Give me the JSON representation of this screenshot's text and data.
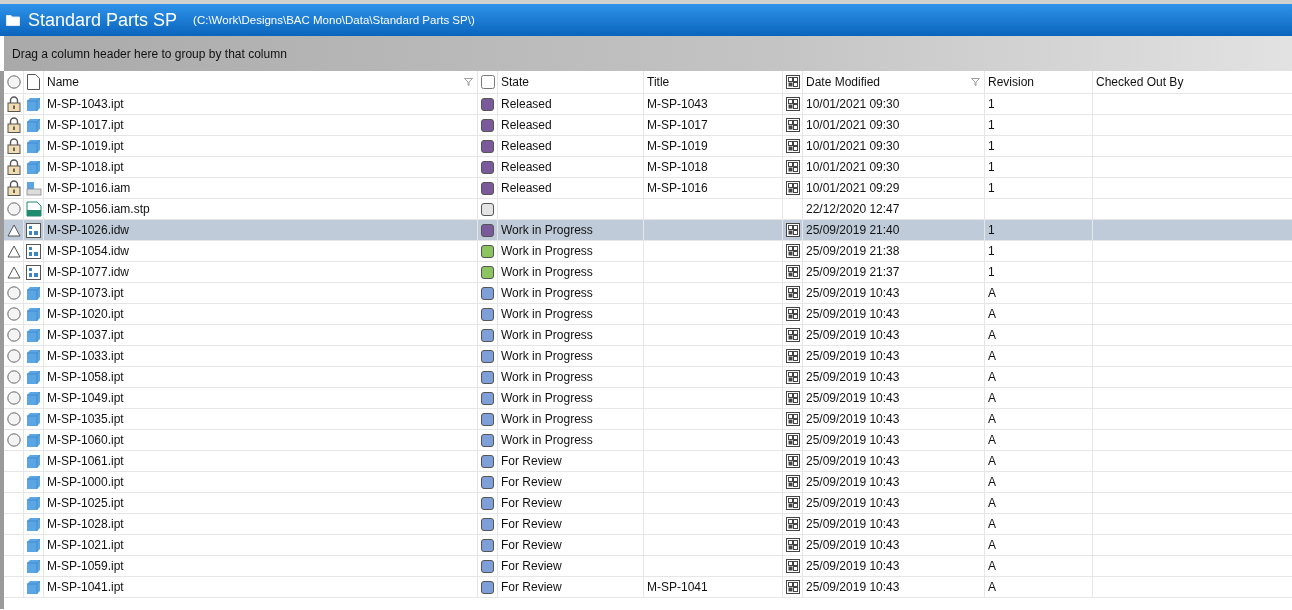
{
  "window": {
    "title": "Standard Parts SP",
    "path": "(C:\\Work\\Designs\\BAC Mono\\Data\\Standard Parts SP\\)"
  },
  "group_hint": "Drag a column header here to group by that column",
  "table": {
    "columns": [
      {
        "kind": "status"
      },
      {
        "kind": "file"
      },
      {
        "kind": "text",
        "label": "Name",
        "filter": true
      },
      {
        "kind": "statebox"
      },
      {
        "kind": "text",
        "label": "State",
        "filter": false
      },
      {
        "kind": "text",
        "label": "Title",
        "filter": false
      },
      {
        "kind": "dateicon"
      },
      {
        "kind": "text",
        "label": "Date Modified",
        "filter": true
      },
      {
        "kind": "text",
        "label": "Revision",
        "filter": false
      },
      {
        "kind": "text",
        "label": "Checked Out By",
        "filter": false
      }
    ],
    "rows": [
      {
        "status": {
          "kind": "lock"
        },
        "file": {
          "kind": "part"
        },
        "name": "M-SP-1043.ipt",
        "swatch": {
          "color": "#7b5a9c"
        },
        "state": "Released",
        "title": "M-SP-1043",
        "date_icon": true,
        "date": "10/01/2021 09:30",
        "revision": "1",
        "selected": false
      },
      {
        "status": {
          "kind": "lock"
        },
        "file": {
          "kind": "part"
        },
        "name": "M-SP-1017.ipt",
        "swatch": {
          "color": "#7b5a9c"
        },
        "state": "Released",
        "title": "M-SP-1017",
        "date_icon": true,
        "date": "10/01/2021 09:30",
        "revision": "1",
        "selected": false
      },
      {
        "status": {
          "kind": "lock"
        },
        "file": {
          "kind": "part"
        },
        "name": "M-SP-1019.ipt",
        "swatch": {
          "color": "#7b5a9c"
        },
        "state": "Released",
        "title": "M-SP-1019",
        "date_icon": true,
        "date": "10/01/2021 09:30",
        "revision": "1",
        "selected": false
      },
      {
        "status": {
          "kind": "lock"
        },
        "file": {
          "kind": "part"
        },
        "name": "M-SP-1018.ipt",
        "swatch": {
          "color": "#7b5a9c"
        },
        "state": "Released",
        "title": "M-SP-1018",
        "date_icon": true,
        "date": "10/01/2021 09:30",
        "revision": "1",
        "selected": false
      },
      {
        "status": {
          "kind": "lock"
        },
        "file": {
          "kind": "assembly"
        },
        "name": "M-SP-1016.iam",
        "swatch": {
          "color": "#7b5a9c"
        },
        "state": "Released",
        "title": "M-SP-1016",
        "date_icon": true,
        "date": "10/01/2021 09:29",
        "revision": "1",
        "selected": false
      },
      {
        "status": {
          "kind": "circle"
        },
        "file": {
          "kind": "stp"
        },
        "name": "M-SP-1056.iam.stp",
        "swatch": {
          "color": "#e4e4e4"
        },
        "date_icon": false,
        "date": "22/12/2020 12:47",
        "selected": false
      },
      {
        "status": {
          "kind": "triangle"
        },
        "file": {
          "kind": "drawing"
        },
        "name": "M-SP-1026.idw",
        "swatch": {
          "color": "#7b5a9c"
        },
        "state": "Work in Progress",
        "date_icon": true,
        "date": "25/09/2019 21:40",
        "revision": "1",
        "selected": true
      },
      {
        "status": {
          "kind": "triangle"
        },
        "file": {
          "kind": "drawing"
        },
        "name": "M-SP-1054.idw",
        "swatch": {
          "color": "#8cc460"
        },
        "state": "Work in Progress",
        "date_icon": true,
        "date": "25/09/2019 21:38",
        "revision": "1",
        "selected": false
      },
      {
        "status": {
          "kind": "triangle"
        },
        "file": {
          "kind": "drawing"
        },
        "name": "M-SP-1077.idw",
        "swatch": {
          "color": "#8cc460"
        },
        "state": "Work in Progress",
        "date_icon": true,
        "date": "25/09/2019 21:37",
        "revision": "1",
        "selected": false
      },
      {
        "status": {
          "kind": "circle"
        },
        "file": {
          "kind": "part"
        },
        "name": "M-SP-1073.ipt",
        "swatch": {
          "color": "#7f9fd8"
        },
        "state": "Work in Progress",
        "date_icon": true,
        "date": "25/09/2019 10:43",
        "revision": "A",
        "selected": false
      },
      {
        "status": {
          "kind": "circle"
        },
        "file": {
          "kind": "part"
        },
        "name": "M-SP-1020.ipt",
        "swatch": {
          "color": "#7f9fd8"
        },
        "state": "Work in Progress",
        "date_icon": true,
        "date": "25/09/2019 10:43",
        "revision": "A",
        "selected": false
      },
      {
        "status": {
          "kind": "circle"
        },
        "file": {
          "kind": "part"
        },
        "name": "M-SP-1037.ipt",
        "swatch": {
          "color": "#7f9fd8"
        },
        "state": "Work in Progress",
        "date_icon": true,
        "date": "25/09/2019 10:43",
        "revision": "A",
        "selected": false
      },
      {
        "status": {
          "kind": "circle"
        },
        "file": {
          "kind": "part"
        },
        "name": "M-SP-1033.ipt",
        "swatch": {
          "color": "#7f9fd8"
        },
        "state": "Work in Progress",
        "date_icon": true,
        "date": "25/09/2019 10:43",
        "revision": "A",
        "selected": false
      },
      {
        "status": {
          "kind": "circle"
        },
        "file": {
          "kind": "part"
        },
        "name": "M-SP-1058.ipt",
        "swatch": {
          "color": "#7f9fd8"
        },
        "state": "Work in Progress",
        "date_icon": true,
        "date": "25/09/2019 10:43",
        "revision": "A",
        "selected": false
      },
      {
        "status": {
          "kind": "circle"
        },
        "file": {
          "kind": "part"
        },
        "name": "M-SP-1049.ipt",
        "swatch": {
          "color": "#7f9fd8"
        },
        "state": "Work in Progress",
        "date_icon": true,
        "date": "25/09/2019 10:43",
        "revision": "A",
        "selected": false
      },
      {
        "status": {
          "kind": "circle"
        },
        "file": {
          "kind": "part"
        },
        "name": "M-SP-1035.ipt",
        "swatch": {
          "color": "#7f9fd8"
        },
        "state": "Work in Progress",
        "date_icon": true,
        "date": "25/09/2019 10:43",
        "revision": "A",
        "selected": false
      },
      {
        "status": {
          "kind": "circle"
        },
        "file": {
          "kind": "part"
        },
        "name": "M-SP-1060.ipt",
        "swatch": {
          "color": "#7f9fd8"
        },
        "state": "Work in Progress",
        "date_icon": true,
        "date": "25/09/2019 10:43",
        "revision": "A",
        "selected": false
      },
      {
        "file": {
          "kind": "part"
        },
        "name": "M-SP-1061.ipt",
        "swatch": {
          "color": "#7f9fd8"
        },
        "state": "For Review",
        "date_icon": true,
        "date": "25/09/2019 10:43",
        "revision": "A",
        "selected": false
      },
      {
        "file": {
          "kind": "part"
        },
        "name": "M-SP-1000.ipt",
        "swatch": {
          "color": "#7f9fd8"
        },
        "state": "For Review",
        "date_icon": true,
        "date": "25/09/2019 10:43",
        "revision": "A",
        "selected": false
      },
      {
        "file": {
          "kind": "part"
        },
        "name": "M-SP-1025.ipt",
        "swatch": {
          "color": "#7f9fd8"
        },
        "state": "For Review",
        "date_icon": true,
        "date": "25/09/2019 10:43",
        "revision": "A",
        "selected": false
      },
      {
        "file": {
          "kind": "part"
        },
        "name": "M-SP-1028.ipt",
        "swatch": {
          "color": "#7f9fd8"
        },
        "state": "For Review",
        "date_icon": true,
        "date": "25/09/2019 10:43",
        "revision": "A",
        "selected": false
      },
      {
        "file": {
          "kind": "part"
        },
        "name": "M-SP-1021.ipt",
        "swatch": {
          "color": "#7f9fd8"
        },
        "state": "For Review",
        "date_icon": true,
        "date": "25/09/2019 10:43",
        "revision": "A",
        "selected": false
      },
      {
        "file": {
          "kind": "part"
        },
        "name": "M-SP-1059.ipt",
        "swatch": {
          "color": "#7f9fd8"
        },
        "state": "For Review",
        "date_icon": true,
        "date": "25/09/2019 10:43",
        "revision": "A",
        "selected": false
      },
      {
        "file": {
          "kind": "part"
        },
        "name": "M-SP-1041.ipt",
        "swatch": {
          "color": "#7f9fd8"
        },
        "state": "For Review",
        "title": "M-SP-1041",
        "date_icon": true,
        "date": "25/09/2019 10:43",
        "revision": "A",
        "selected": false
      }
    ]
  }
}
